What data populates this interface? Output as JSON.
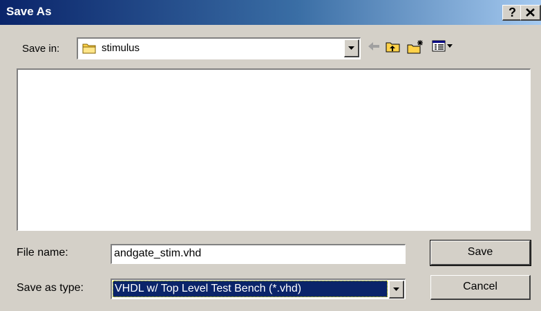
{
  "window": {
    "title": "Save As"
  },
  "title_buttons": {
    "help": "?",
    "close": "close"
  },
  "save_in": {
    "label": "Save in:",
    "value": "stimulus",
    "icon": "folder-icon"
  },
  "toolbar": {
    "icons": [
      "back-arrow-icon",
      "up-one-level-icon",
      "create-new-folder-icon",
      "view-menu-icon"
    ]
  },
  "file_name": {
    "label": "File name:",
    "value": "andgate_stim.vhd"
  },
  "save_as_type": {
    "label": "Save as type:",
    "value": "VHDL w/ Top Level Test Bench (*.vhd)"
  },
  "buttons": {
    "save": "Save",
    "cancel": "Cancel"
  },
  "colors": {
    "face": "#d4d0c8",
    "title_start": "#0a246a",
    "title_end": "#a6caf0",
    "selection": "#0a246a",
    "folder": "#ffd24a"
  }
}
